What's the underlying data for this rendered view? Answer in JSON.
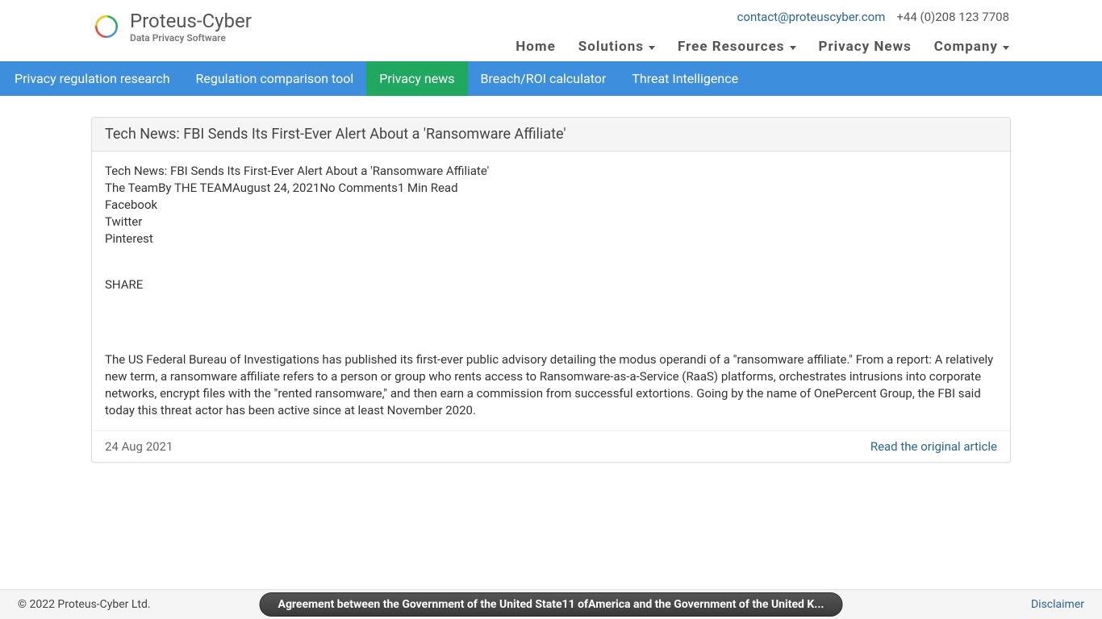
{
  "header": {
    "brand_name": "Proteus-Cyber",
    "brand_tag": "Data Privacy Software",
    "contact_email": "contact@proteuscyber.com",
    "contact_phone": "+44 (0)208 123 7708",
    "nav": {
      "home": "Home",
      "solutions": "Solutions",
      "free_resources": "Free Resources",
      "privacy_news": "Privacy News",
      "company": "Company"
    }
  },
  "subnav": {
    "items": [
      "Privacy regulation research",
      "Regulation comparison tool",
      "Privacy news",
      "Breach/ROI calculator",
      "Threat Intelligence"
    ],
    "active_index": 2
  },
  "article": {
    "title": "Tech News: FBI Sends Its First-Ever Alert About a 'Ransomware Affiliate'",
    "line1": "Tech News: FBI Sends Its First-Ever Alert About a 'Ransomware Affiliate'",
    "line2": "The TeamBy THE TEAMAugust 24, 2021No Comments1 Min Read",
    "line3": "Facebook",
    "line4": "Twitter",
    "line5": "Pinterest",
    "share": "SHARE",
    "body": "The US Federal Bureau of Investigations has published its first-ever public advisory detailing the modus operandi of a \"ransomware affiliate.\" From a report: A relatively new term, a ransomware affiliate refers to a person or group who rents access to Ransomware-as-a-Service (RaaS) platforms, orchestrates intrusions into corporate networks, encrypt files with the \"rented ransomware,\" and then earn a commission from successful extortions. Going by the name of OnePercent Group, the FBI said today this threat actor has been active since at least November 2020.",
    "date": "24 Aug 2021",
    "read_original": "Read the original article"
  },
  "footer": {
    "copyright": "© 2022 Proteus-Cyber Ltd.",
    "pill": "Agreement between the Government of the United State11 ofAmerica and the Government of the United K...",
    "disclaimer": "Disclaimer"
  }
}
